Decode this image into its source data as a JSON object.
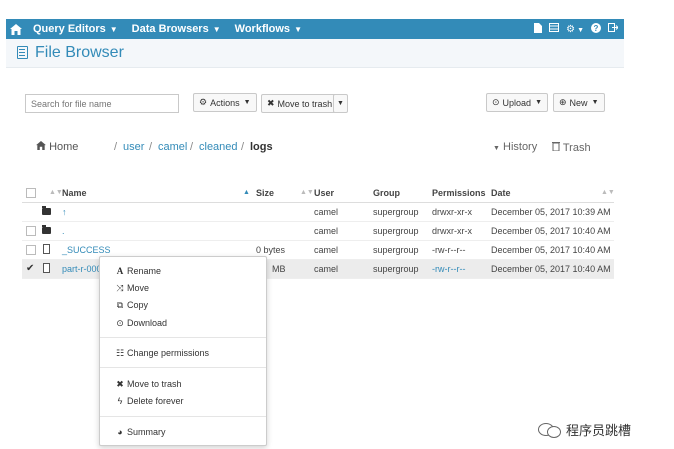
{
  "navbar": {
    "items": [
      {
        "label": "Query Editors"
      },
      {
        "label": "Data Browsers"
      },
      {
        "label": "Workflows"
      }
    ]
  },
  "header": {
    "title": "File Browser"
  },
  "search": {
    "placeholder": "Search for file name"
  },
  "toolbar": {
    "actions_label": "Actions",
    "move_to_trash_label": "Move to trash",
    "upload_label": "Upload",
    "new_label": "New"
  },
  "breadcrumb": {
    "home": "Home",
    "path": [
      "user",
      "camel",
      "cleaned"
    ],
    "separator": "/",
    "current": "logs",
    "history": "History",
    "trash": "Trash"
  },
  "table": {
    "headers": [
      "Name",
      "Size",
      "User",
      "Group",
      "Permissions",
      "Date"
    ],
    "rows": [
      {
        "name": "↑",
        "size": "",
        "user": "camel",
        "group": "supergroup",
        "permissions": "drwxr-xr-x",
        "date": "December 05, 2017 10:39 AM",
        "type": "folder"
      },
      {
        "name": ".",
        "size": "",
        "user": "camel",
        "group": "supergroup",
        "permissions": "drwxr-xr-x",
        "date": "December 05, 2017 10:40 AM",
        "type": "folder"
      },
      {
        "name": "_SUCCESS",
        "size": "0 bytes",
        "user": "camel",
        "group": "supergroup",
        "permissions": "-rw-r--r--",
        "date": "December 05, 2017 10:40 AM",
        "type": "file"
      },
      {
        "name": "part-r-000",
        "size": "MB",
        "user": "camel",
        "group": "supergroup",
        "permissions": "-rw-r--r--",
        "date": "December 05, 2017 10:40 AM",
        "type": "file",
        "selected": true
      }
    ]
  },
  "context_menu": {
    "items": [
      "Rename",
      "Move",
      "Copy",
      "Download",
      "Change permissions",
      "Move to trash",
      "Delete forever",
      "Summary"
    ]
  },
  "watermark": {
    "text": "程序员跳槽"
  },
  "colors": {
    "brand": "#338bb8",
    "header_bg": "#f4f7fa",
    "selected_row": "#ececec"
  }
}
